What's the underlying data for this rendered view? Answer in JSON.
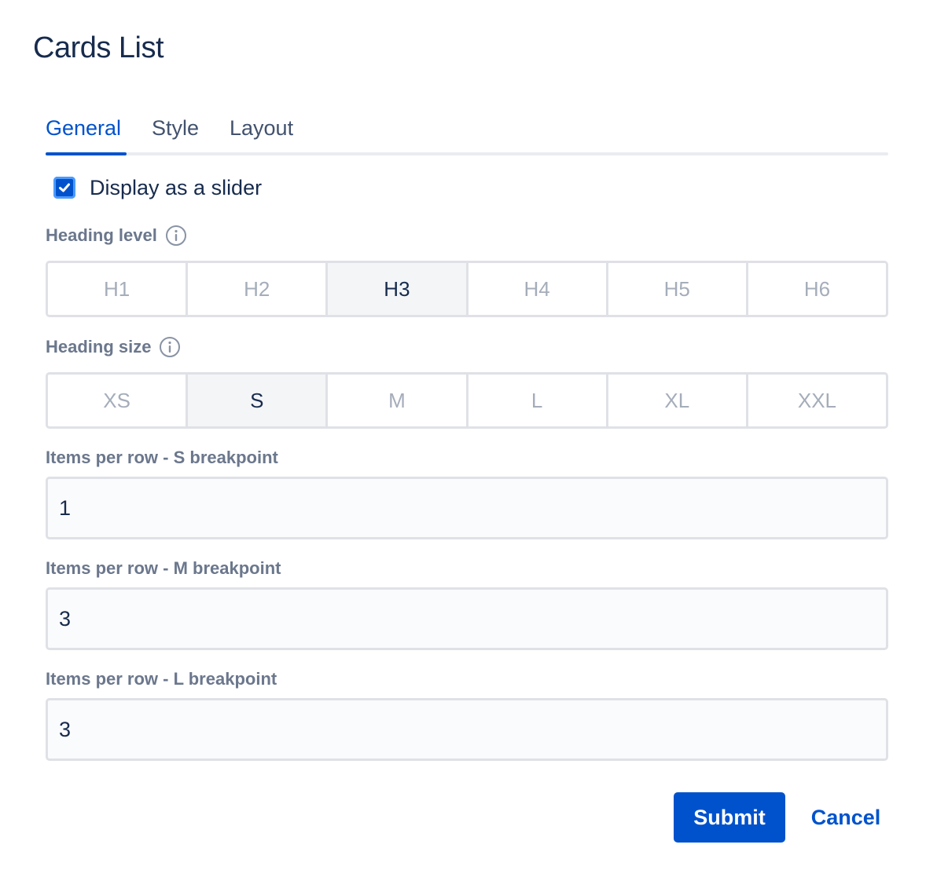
{
  "dialog": {
    "title": "Cards List"
  },
  "tabs": [
    {
      "label": "General",
      "active": true
    },
    {
      "label": "Style",
      "active": false
    },
    {
      "label": "Layout",
      "active": false
    }
  ],
  "slider_option": {
    "label": "Display as a slider",
    "checked": true
  },
  "heading_level": {
    "label": "Heading level",
    "options": [
      "H1",
      "H2",
      "H3",
      "H4",
      "H5",
      "H6"
    ],
    "selected": "H3"
  },
  "heading_size": {
    "label": "Heading size",
    "options": [
      "XS",
      "S",
      "M",
      "L",
      "XL",
      "XXL"
    ],
    "selected": "S"
  },
  "items_s": {
    "label": "Items per row - S breakpoint",
    "value": "1"
  },
  "items_m": {
    "label": "Items per row - M breakpoint",
    "value": "3"
  },
  "items_l": {
    "label": "Items per row - L breakpoint",
    "value": "3"
  },
  "actions": {
    "submit_label": "Submit",
    "cancel_label": "Cancel"
  },
  "colors": {
    "primary": "#0052cc",
    "text": "#172b4d",
    "label": "#6b778c",
    "border": "#dfe1e6"
  },
  "icons": {
    "checkbox": "check-icon",
    "info": "info-icon"
  }
}
